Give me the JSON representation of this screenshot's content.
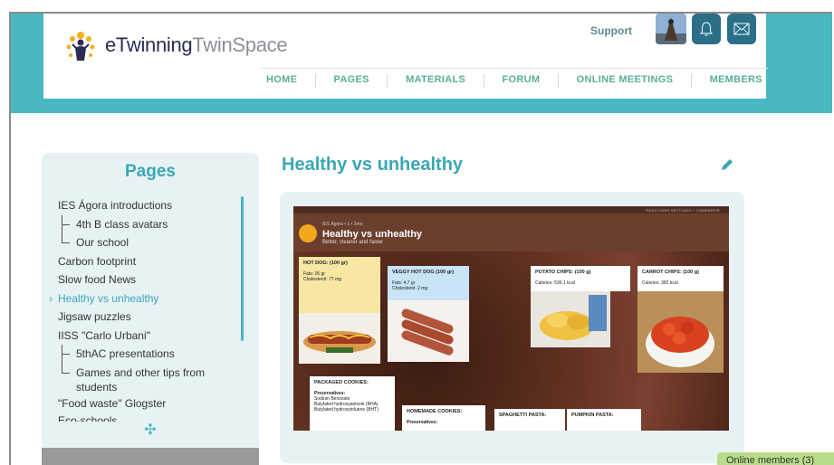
{
  "header": {
    "logo_text_main": "eTwinning",
    "logo_text_accent": "TwinSpace",
    "support_label": "Support"
  },
  "nav": {
    "items": [
      "HOME",
      "PAGES",
      "MATERIALS",
      "FORUM",
      "ONLINE MEETINGS",
      "MEMBERS"
    ]
  },
  "sidebar": {
    "title": "Pages",
    "items": [
      {
        "label": "IES Ágora introductions",
        "level": 0
      },
      {
        "label": "4th B class avatars",
        "level": 1
      },
      {
        "label": "Our school",
        "level": 1
      },
      {
        "label": "Carbon footprint",
        "level": 0
      },
      {
        "label": "Slow food News",
        "level": 0
      },
      {
        "label": "Healthy vs unhealthy",
        "level": 0,
        "active": true
      },
      {
        "label": "Jigsaw puzzles",
        "level": 0
      },
      {
        "label": "IISS \"Carlo Urbani\"",
        "level": 0
      },
      {
        "label": "5thAC presentations",
        "level": 1
      },
      {
        "label": "Games and other tips from students",
        "level": 1
      },
      {
        "label": "\"Food waste\" Glogster",
        "level": 0
      },
      {
        "label": "Eco-schools",
        "level": 0
      }
    ],
    "move_icon": "move-icon"
  },
  "main": {
    "title": "Healthy vs unhealthy",
    "edit_icon": "pencil-icon"
  },
  "padlet": {
    "topbar": "REACTIONS  SETTINGS  + COMPARTIR",
    "meta": "IES Ágora • 1 • 2mo",
    "title": "Healthy vs unhealthy",
    "subtitle": "Better, cleaner and faster",
    "posts": [
      {
        "title": "HOT DOG: (100 gr)",
        "line1": "Fats: 26 gr",
        "line2": "Cholesterol: 77 mg"
      },
      {
        "title": "VEGGY HOT DOG (100 gr)",
        "line1": "Fats: 4,7 gr",
        "line2": "Cholesterol: 2 mg"
      },
      {
        "title": "POTATO CHIPS: (100 g)",
        "line1": "Calories: 536,1 kcal",
        "line2": ""
      },
      {
        "title": "CARROT CHIPS: (100 g)",
        "line1": "Calories: 382 kcal",
        "line2": ""
      },
      {
        "title": "PACKAGED COOKIES:",
        "line1": "Preservatives:",
        "line2": "Sodium Benzoate",
        "line3": "Butylated hydroxyanisole (BHA)",
        "line4": "Butylated hydroxytoluene (BHT)"
      },
      {
        "title": "HOMEMADE COOKIES:",
        "line1": "Preservatives:",
        "line2": ""
      },
      {
        "title": "SPAGHETTI PASTA:",
        "line1": "",
        "line2": ""
      },
      {
        "title": "PUMPKIN PASTA:",
        "line1": "",
        "line2": ""
      }
    ]
  },
  "online": {
    "label": "Online members (3)"
  },
  "colors": {
    "teal": "#49b8c2",
    "accent": "#3aa7b5",
    "nav_green": "#5bae9a",
    "icon_btn": "#2a6f87",
    "sidebar_bg": "#e7f2f5"
  }
}
